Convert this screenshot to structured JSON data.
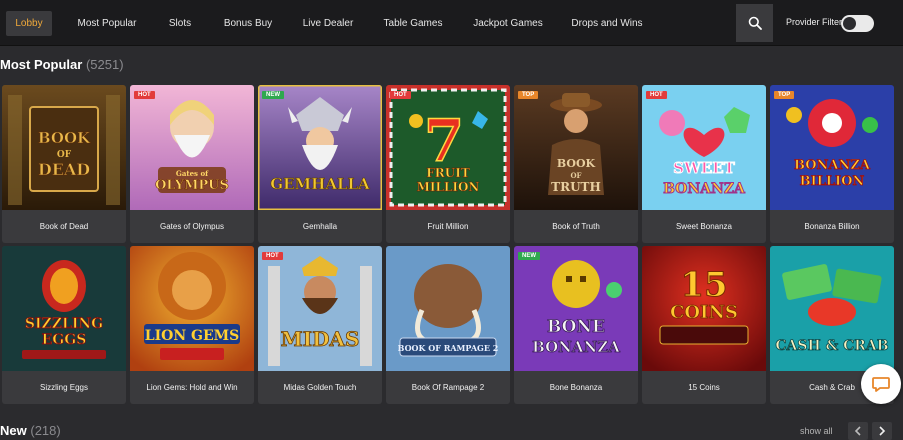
{
  "nav": {
    "items": [
      "Lobby",
      "Most Popular",
      "Slots",
      "Bonus Buy",
      "Live Dealer",
      "Table Games",
      "Jackpot Games",
      "Drops and Wins"
    ],
    "provider_filter_label": "Provider Filter",
    "accent_color": "#f0a93a"
  },
  "most_popular": {
    "title": "Most Popular",
    "count": "(5251)",
    "games": [
      {
        "name": "Book of Dead",
        "badge": "",
        "logo": "BOOK OF DEAD"
      },
      {
        "name": "Gates of Olympus",
        "badge": "HOT",
        "logo": "Gates of OLYMPUS"
      },
      {
        "name": "Gemhalla",
        "badge": "NEW",
        "logo": "GEMHALLA"
      },
      {
        "name": "Fruit Million",
        "badge": "HOT",
        "logo": "FRUIT MILLION"
      },
      {
        "name": "Book of Truth",
        "badge": "TOP",
        "logo": "BOOK OF TRUTH"
      },
      {
        "name": "Sweet Bonanza",
        "badge": "HOT",
        "logo": "SWEET BONANZA"
      },
      {
        "name": "Bonanza Billion",
        "badge": "TOP",
        "logo": "BONANZA BILLION"
      },
      {
        "name": "Sizzling Eggs",
        "badge": "",
        "logo": "SIZZLING EGGS"
      },
      {
        "name": "Lion Gems: Hold and Win",
        "badge": "",
        "logo": "LION GEMS"
      },
      {
        "name": "Midas Golden Touch",
        "badge": "HOT",
        "logo": "MIDAS"
      },
      {
        "name": "Book Of Rampage 2",
        "badge": "",
        "logo": "BOOK OF RAMPAGE 2"
      },
      {
        "name": "Bone Bonanza",
        "badge": "NEW",
        "logo": "BONE BONANZA"
      },
      {
        "name": "15 Coins",
        "badge": "",
        "logo": "15 COINS"
      },
      {
        "name": "Cash & Crab",
        "badge": "",
        "logo": "CASH & CRAB"
      }
    ]
  },
  "new_section": {
    "title": "New",
    "count": "(218)",
    "show_all": "show all"
  },
  "icons": {
    "search": "search-icon",
    "chat": "chat-icon",
    "prev": "chevron-left-icon",
    "next": "chevron-right-icon"
  }
}
